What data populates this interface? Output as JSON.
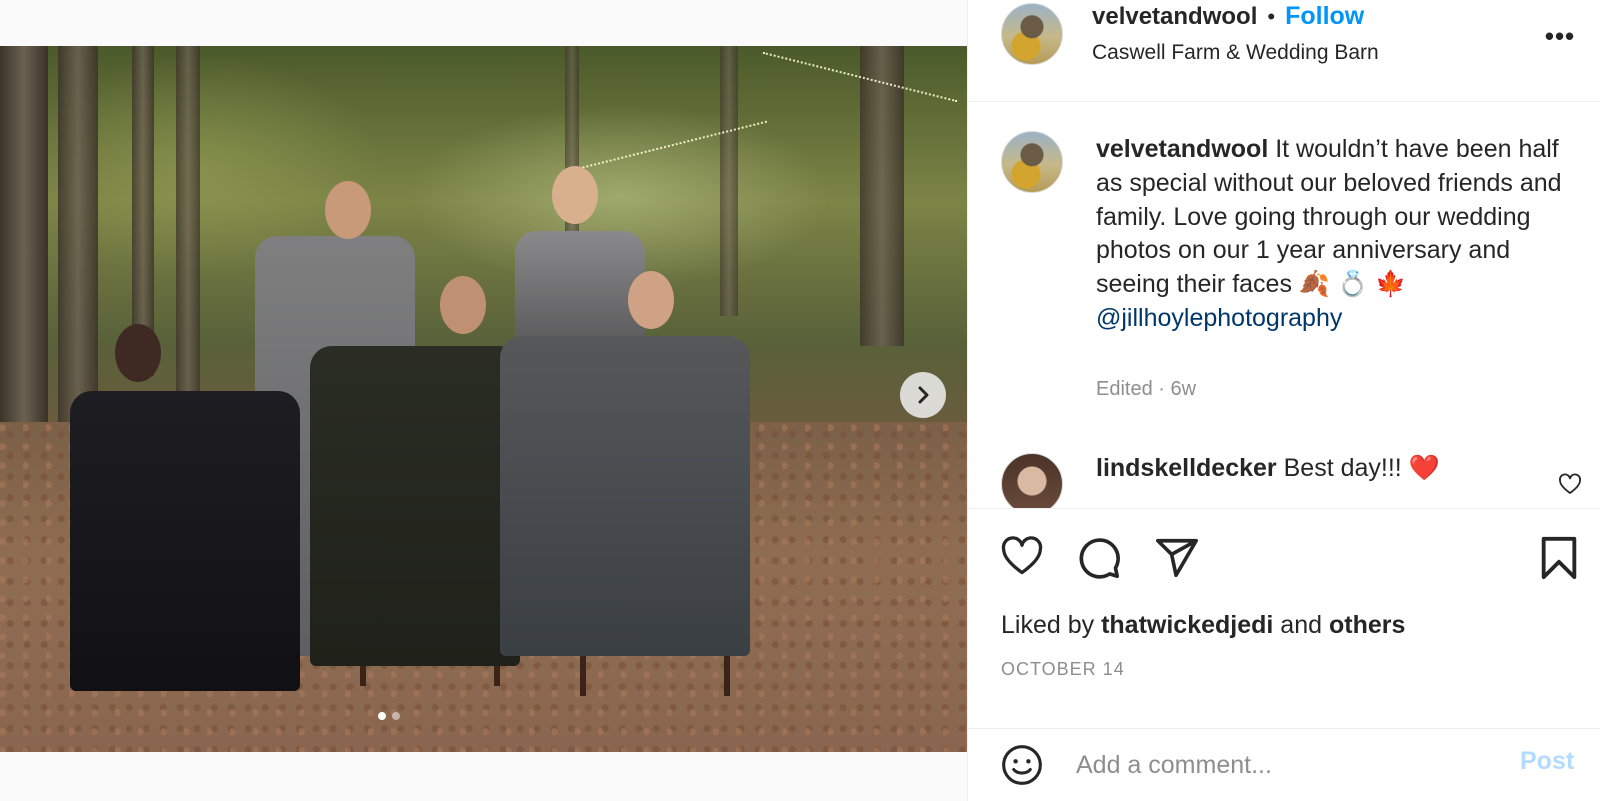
{
  "post": {
    "username": "velvetandwool",
    "follow_label": "Follow",
    "separator": "•",
    "location": "Caswell Farm & Wedding Barn",
    "more_label": "•••"
  },
  "media": {
    "photo_alt": "Groomsmen photo in an autumn forest",
    "next_label": "Next",
    "carousel_count": 2,
    "active_index": 0
  },
  "caption": {
    "username": "velvetandwool",
    "text": "It wouldn’t have been half as special without our beloved friends and family. Love going through our wedding photos on our 1 year anniversary and seeing their faces 🍂 💍 🍁",
    "mention": "@jillhoylephotography",
    "edited": "Edited · 6w"
  },
  "comments": [
    {
      "username": "lindskelldecker",
      "text": "Best day!!! ❤️"
    }
  ],
  "actions": {
    "like_icon": "heart-icon",
    "comment_icon": "comment-icon",
    "share_icon": "paper-plane-icon",
    "save_icon": "bookmark-icon"
  },
  "likes": {
    "prefix": "Liked by",
    "user": "thatwickedjedi",
    "and": "and",
    "others": "others"
  },
  "date": "OCTOBER 14",
  "add_comment": {
    "emoji_icon": "smiley-icon",
    "placeholder": "Add a comment...",
    "post_label": "Post"
  },
  "colors": {
    "accent": "#0095f6",
    "post_disabled": "#b3dbff",
    "muted": "#8e8e8e",
    "mention": "#00376b",
    "text": "#262626"
  }
}
